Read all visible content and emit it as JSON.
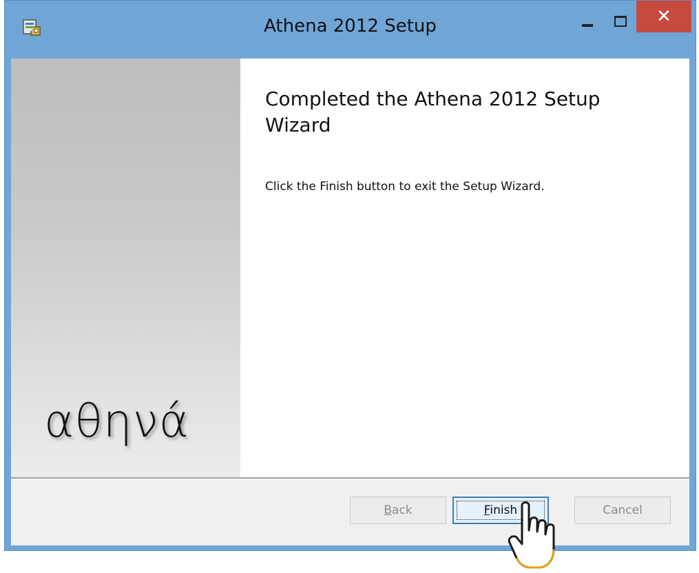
{
  "window": {
    "title": "Athena 2012 Setup",
    "icons": {
      "app": "installer-icon",
      "minimize": "minimize-icon",
      "maximize": "maximize-icon",
      "close": "close-icon"
    },
    "close_glyph": "✕",
    "colors": {
      "titlebar": "#6fa6d6",
      "close": "#c74a41"
    }
  },
  "banner": {
    "logo_text": "αθηνά"
  },
  "content": {
    "heading": "Completed the Athena 2012 Setup Wizard",
    "body": "Click the Finish button to exit the Setup Wizard."
  },
  "buttons": {
    "back": {
      "first": "B",
      "rest": "ack",
      "enabled": false
    },
    "finish": {
      "first": "F",
      "rest": "inish",
      "focused": true
    },
    "cancel": {
      "label": "Cancel",
      "enabled": false
    }
  },
  "cursor": "hand-pointer-icon"
}
